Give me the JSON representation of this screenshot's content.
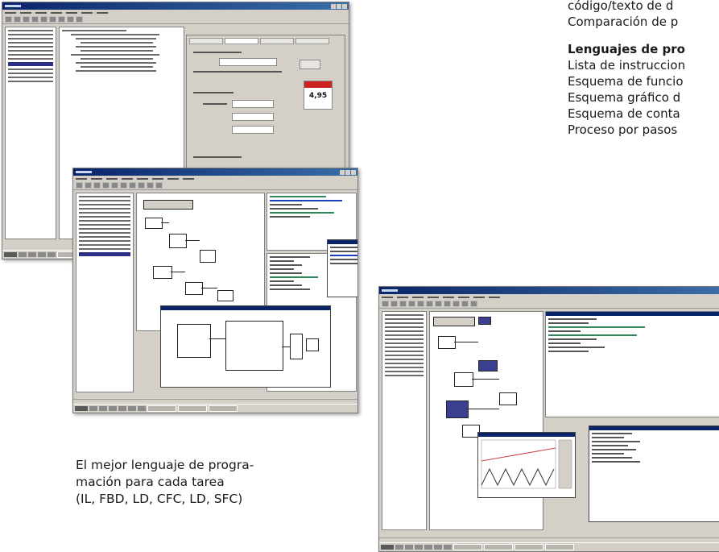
{
  "right_text": {
    "top_lines": [
      "código/texto de d",
      "Comparación de p"
    ],
    "heading": "Lenguajes de pro",
    "list": [
      "Lista de instruccion",
      "Esquema de funcio",
      "Esquema gráfico d",
      "Esquema de conta",
      "Proceso por pasos"
    ]
  },
  "caption": {
    "lines": [
      "El mejor lenguaje de progra-",
      "mación para cada tarea",
      "(IL, FBD, LD, CFC, LD, SFC)"
    ]
  },
  "screenshot_2": {
    "badge_value": "4,95"
  },
  "colors": {
    "window_gray": "#d4d0c8",
    "title_blue": "#0a246a",
    "selection_blue": "#2b2f86",
    "badge_red": "#cc2222"
  }
}
